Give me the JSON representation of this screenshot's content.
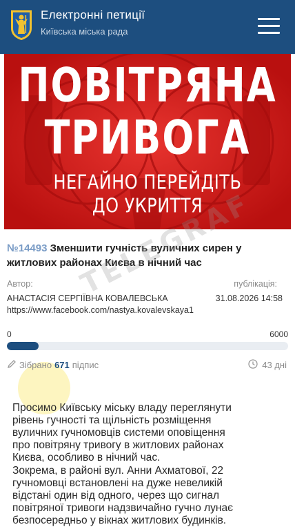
{
  "header": {
    "title": "Електронні петиції",
    "subtitle": "Київська міська рада",
    "logo_icon": "kyiv-coat-of-arms-icon",
    "menu_icon": "hamburger-menu-icon",
    "colors": {
      "background": "#1d4e7f",
      "text": "#ffffff"
    }
  },
  "banner": {
    "line1": "ПОВІТРЯНА",
    "line2": "ТРИВОГА",
    "line3": "НЕГАЙНО ПЕРЕЙДІТЬ",
    "line4": "ДО УКРИТТЯ",
    "background_color": "#d31b1b"
  },
  "petition": {
    "number": "№14493",
    "title": "Зменшити гучність вуличних сирен у житлових районах Києва в нічний час",
    "author_label": "Автор:",
    "author": "АНАСТАСІЯ СЕРГІЇВНА КОВАЛЕВСЬКА",
    "author_link": "https://www.facebook.com/nastya.kovalevskaya1",
    "publication_label": "публікація:",
    "publication_date": "31.08.2026 14:58"
  },
  "progress": {
    "min": "0",
    "max": "6000",
    "signed_count": 671,
    "target": 6000,
    "fraction": 0.112
  },
  "signatures": {
    "prefix": "Зібрано",
    "count": "671",
    "suffix": "підпис",
    "icon": "pen-icon"
  },
  "time_left": {
    "text": "43 дні",
    "icon": "clock-icon"
  },
  "watermark": {
    "text": "TELEGRAF"
  },
  "body": {
    "paragraph1_lines": [
      "Просимо Київську міську владу переглянути",
      "рівень гучності та щільність розміщення",
      "вуличних гучномовців системи оповіщення",
      "про повітряну тривогу в житлових районах",
      "Києва, особливо в нічний час."
    ],
    "paragraph2_lines": [
      "Зокрема, в районі вул. Анни Ахматової, 22",
      "гучномовці встановлені на дуже невеликій",
      "відстані один від одного, через що сигнал",
      "повітряної тривоги надзвичайно гучно лунає",
      "безпосередньо у вікнах житлових будинків."
    ]
  }
}
